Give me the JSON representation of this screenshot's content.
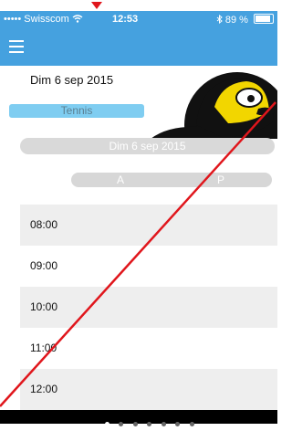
{
  "status_bar": {
    "carrier": "••••• Swisscom",
    "time": "12:53",
    "battery": "89 %"
  },
  "header": {
    "menu_icon": "hamburger-icon"
  },
  "main": {
    "date_label": "Dim 6 sep 2015",
    "category_badge": "Tennis",
    "date_selector": "Dim 6 sep 2015",
    "segments": [
      "A",
      "P"
    ],
    "time_slots": [
      "08:00",
      "09:00",
      "10:00",
      "11:00",
      "12:00"
    ]
  },
  "page_indicator": {
    "pages": 7,
    "active": 0
  },
  "colors": {
    "nav": "#45a1df",
    "badge": "#7fcdf1",
    "annotation": "#e0161c"
  }
}
